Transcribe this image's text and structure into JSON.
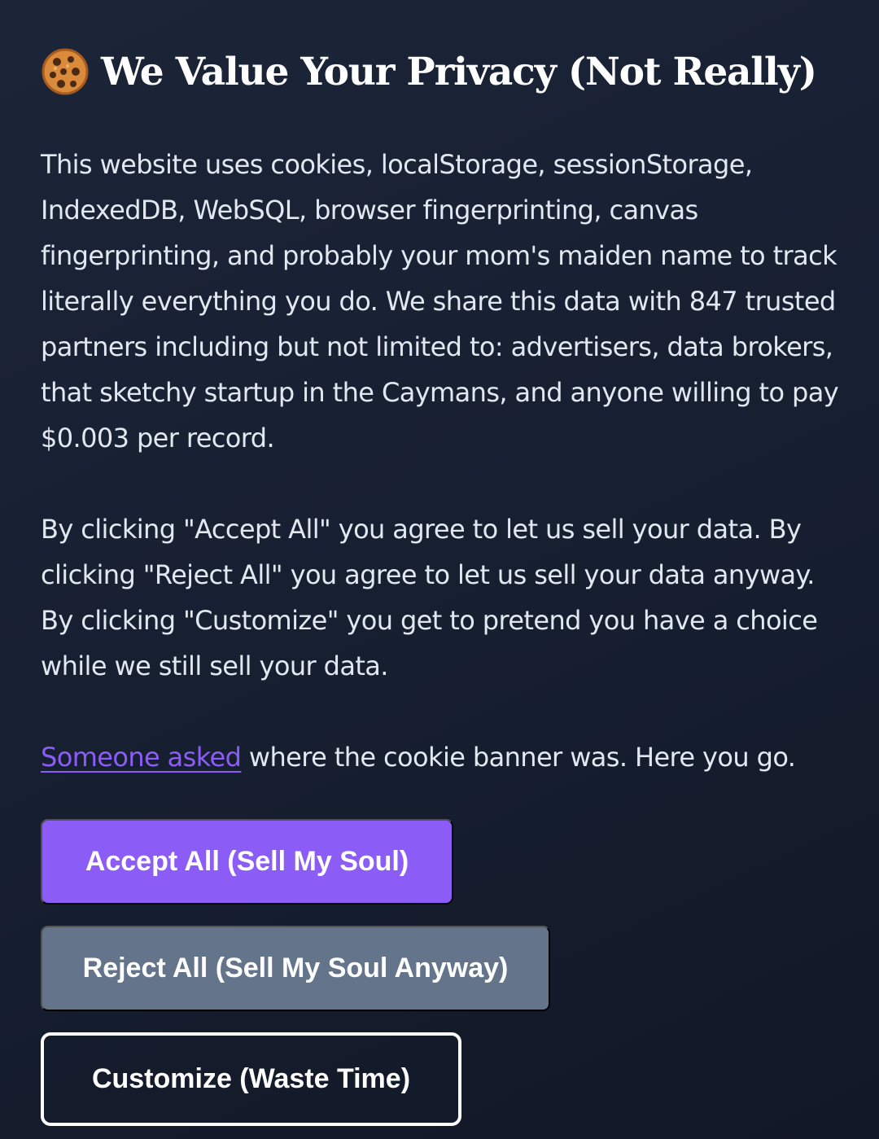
{
  "banner": {
    "title": "We Value Your Privacy (Not Really)",
    "icon": "cookie-icon",
    "paragraph1": "This website uses cookies, localStorage, sessionStorage, IndexedDB, WebSQL, browser fingerprinting, canvas fingerprinting, and probably your mom's maiden name to track literally everything you do. We share this data with 847 trusted partners including but not limited to: advertisers, data brokers, that sketchy startup in the Caymans, and anyone willing to pay $0.003 per record.",
    "paragraph2": "By clicking \"Accept All\" you agree to let us sell your data. By clicking \"Reject All\" you agree to let us sell your data anyway. By clicking \"Customize\" you get to pretend you have a choice while we still sell your data.",
    "link_text": "Someone asked",
    "link_suffix": " where the cookie banner was. Here you go."
  },
  "buttons": {
    "accept_label": "Accept All (Sell My Soul)",
    "reject_label": "Reject All (Sell My Soul Anyway)",
    "customize_label": "Customize (Waste Time)"
  },
  "colors": {
    "background": "#1a2234",
    "accent": "#8b5cf6",
    "reject_button": "#64748b",
    "text": "#e2e8f0"
  }
}
